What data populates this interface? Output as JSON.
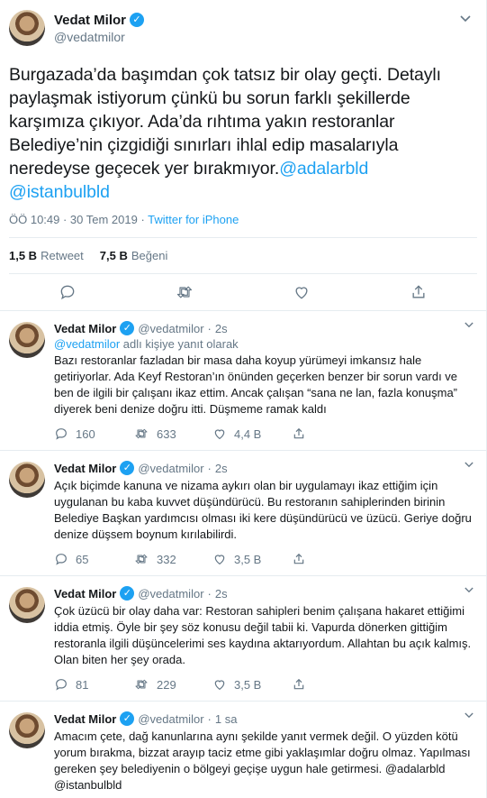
{
  "main_tweet": {
    "name": "Vedat Milor",
    "handle": "@vedatmilor",
    "text": "Burgazada’da başımdan çok tatsız bir olay geçti. Detaylı paylaşmak istiyorum çünkü bu sorun farklı şekillerde karşımıza çıkıyor. Ada’da rıhtıma yakın restoranlar Belediye’nin çizgidiği sınırları ihlal edip masalarıyla neredeyse geçecek yer bırakmıyor.",
    "mention_1": "@adalarbld",
    "mention_2": "@istanbulbld",
    "timestamp": "ÖÖ 10:49 · 30 Tem 2019 · ",
    "source": "Twitter for iPhone",
    "retweet_count": "1,5 B",
    "retweet_label": "Retweet",
    "like_count": "7,5 B",
    "like_label": "Beğeni"
  },
  "replies": [
    {
      "name": "Vedat Milor",
      "handle": "@vedatmilor",
      "time": "2s",
      "replying_to": "@vedatmilor",
      "replying_suffix": " adlı kişiye yanıt olarak",
      "text": "Bazı restoranlar fazladan bir masa daha koyup yürümeyi imkansız hale getiriyorlar. Ada Keyf Restoran’ın önünden geçerken benzer bir sorun vardı ve ben de ilgili bir çalışanı ikaz ettim. Ancak çalışan “sana ne lan, fazla konuşma” diyerek beni denize doğru itti. Düşmeme ramak kaldı",
      "replies": "160",
      "retweets": "633",
      "likes": "4,4 B"
    },
    {
      "name": "Vedat Milor",
      "handle": "@vedatmilor",
      "time": "2s",
      "text": "Açık biçimde kanuna ve nizama aykırı olan bir uygulamayı ikaz ettiğim için uygulanan bu kaba kuvvet düşündürücü. Bu restoranın sahiplerinden birinin Belediye Başkan yardımcısı olması iki kere düşündürücü ve üzücü. Geriye doğru denize düşsem boynum kırılabilirdi.",
      "replies": "65",
      "retweets": "332",
      "likes": "3,5 B"
    },
    {
      "name": "Vedat Milor",
      "handle": "@vedatmilor",
      "time": "2s",
      "text": "Çok üzücü bir olay daha var: Restoran sahipleri benim çalışana hakaret ettiğimi iddia etmiş. Öyle bir şey söz konusu değil tabii ki. Vapurda dönerken gittiğim restoranla ilgili düşüncelerimi ses kaydına aktarıyordum. Allahtan bu açık kalmış. Olan biten her şey orada.",
      "replies": "81",
      "retweets": "229",
      "likes": "3,5 B"
    },
    {
      "name": "Vedat Milor",
      "handle": "@vedatmilor",
      "time": "1 sa",
      "text": "Amacım çete, dağ kanunlarına aynı şekilde yanıt vermek değil. O yüzden kötü yorum bırakma, bizzat arayıp taciz etme gibi yaklaşımlar doğru olmaz. Yapılması gereken şey belediyenin o bölgeyi geçişe uygun hale getirmesi. @adalarbld @istanbulbld"
    }
  ],
  "colors": {
    "accent": "#1da1f2",
    "muted": "#657786",
    "text": "#14171a",
    "border": "#e6ecf0"
  },
  "icons": [
    "chevron-down-icon",
    "verified-icon",
    "reply-icon",
    "retweet-icon",
    "like-icon",
    "share-icon"
  ]
}
